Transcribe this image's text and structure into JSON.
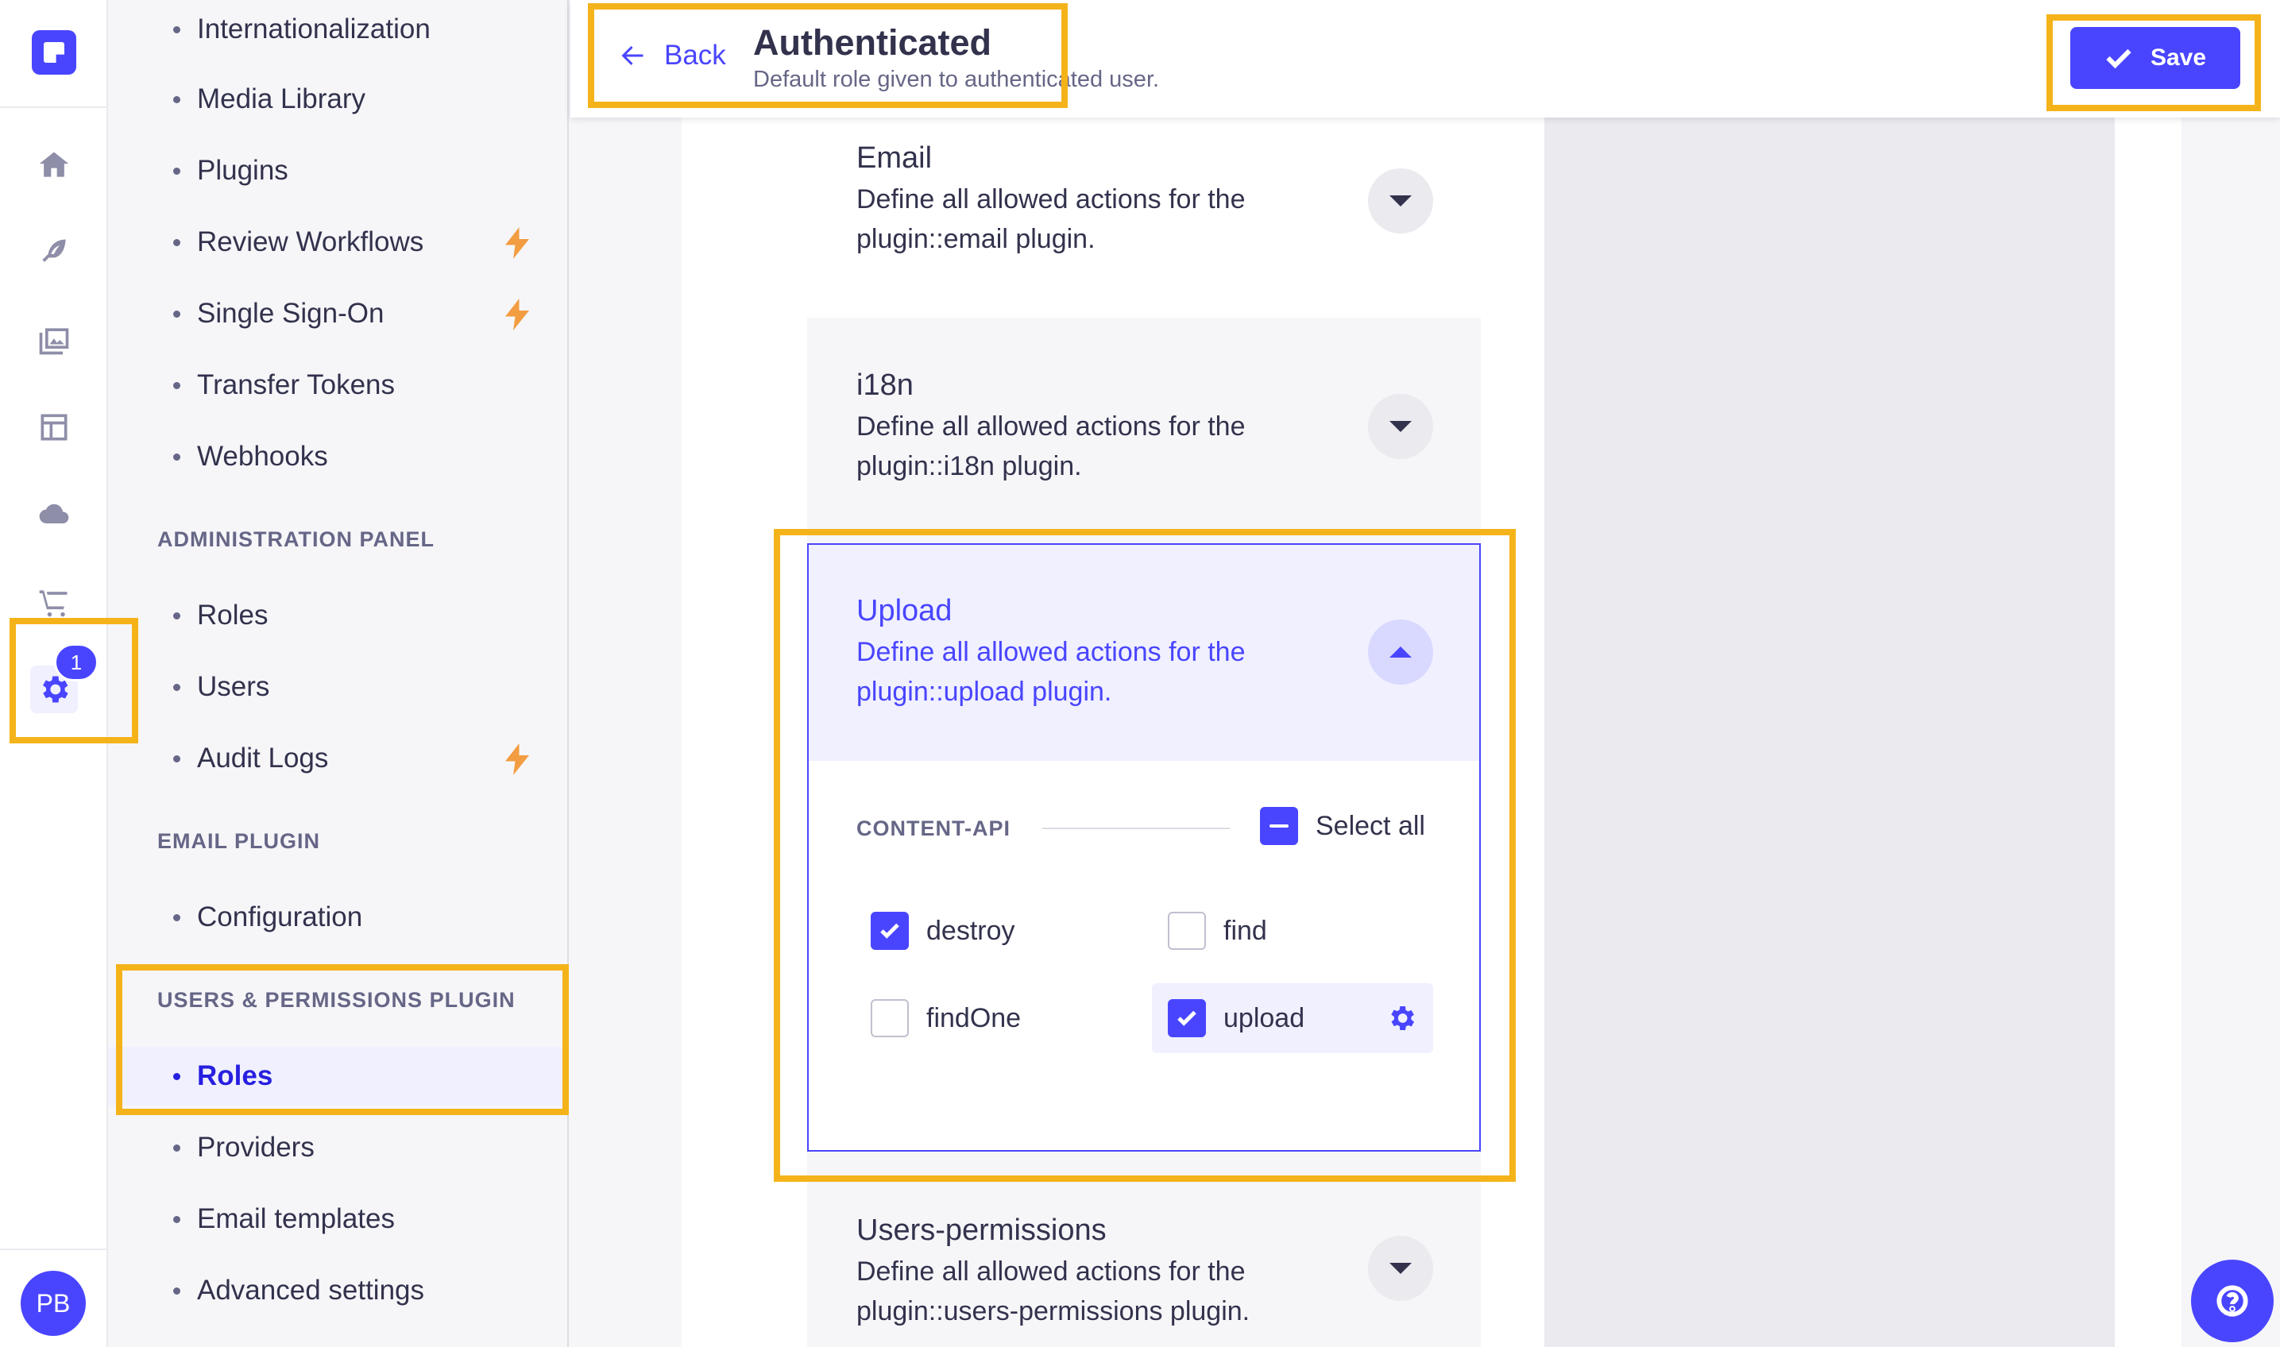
{
  "rail": {
    "icons": [
      "logo-icon",
      "home-icon",
      "content-manager-icon",
      "media-library-icon",
      "content-type-builder-icon",
      "cloud-icon",
      "marketplace-icon",
      "settings-icon"
    ],
    "settings_badge": "1",
    "avatar_initials": "PB"
  },
  "subnav": {
    "items_top": [
      {
        "label": "Internationalization",
        "premium": false
      },
      {
        "label": "Media Library",
        "premium": false
      },
      {
        "label": "Plugins",
        "premium": false
      },
      {
        "label": "Review Workflows",
        "premium": true
      },
      {
        "label": "Single Sign-On",
        "premium": true
      },
      {
        "label": "Transfer Tokens",
        "premium": false
      },
      {
        "label": "Webhooks",
        "premium": false
      }
    ],
    "admin_section": "ADMINISTRATION PANEL",
    "admin_items": [
      "Roles",
      "Users",
      "Audit Logs"
    ],
    "email_section": "EMAIL PLUGIN",
    "email_items": [
      "Configuration"
    ],
    "up_section": "USERS & PERMISSIONS PLUGIN",
    "up_items": [
      "Roles",
      "Providers",
      "Email templates",
      "Advanced settings"
    ],
    "active_item": "Roles"
  },
  "header": {
    "back_label": "Back",
    "title": "Authenticated",
    "subtitle": "Default role given to authenticated user.",
    "save_label": "Save"
  },
  "plugins": {
    "email": {
      "title": "Email",
      "desc": "Define all allowed actions for the plugin::email plugin."
    },
    "i18n": {
      "title": "i18n",
      "desc": "Define all allowed actions for the plugin::i18n plugin."
    },
    "upload": {
      "title": "Upload",
      "desc": "Define all allowed actions for the plugin::upload plugin."
    },
    "users_permissions": {
      "title": "Users-permissions",
      "desc": "Define all allowed actions for the plugin::users-permissions plugin."
    }
  },
  "upload_panel": {
    "section_label": "CONTENT-API",
    "select_all_label": "Select all",
    "select_all_state": "indeterminate",
    "permissions": [
      {
        "label": "destroy",
        "checked": true
      },
      {
        "label": "find",
        "checked": false
      },
      {
        "label": "findOne",
        "checked": false
      },
      {
        "label": "upload",
        "checked": true
      }
    ]
  },
  "colors": {
    "primary": "#4945ff",
    "highlight": "#f5b31a",
    "premium_bolt": "#f29d41"
  }
}
